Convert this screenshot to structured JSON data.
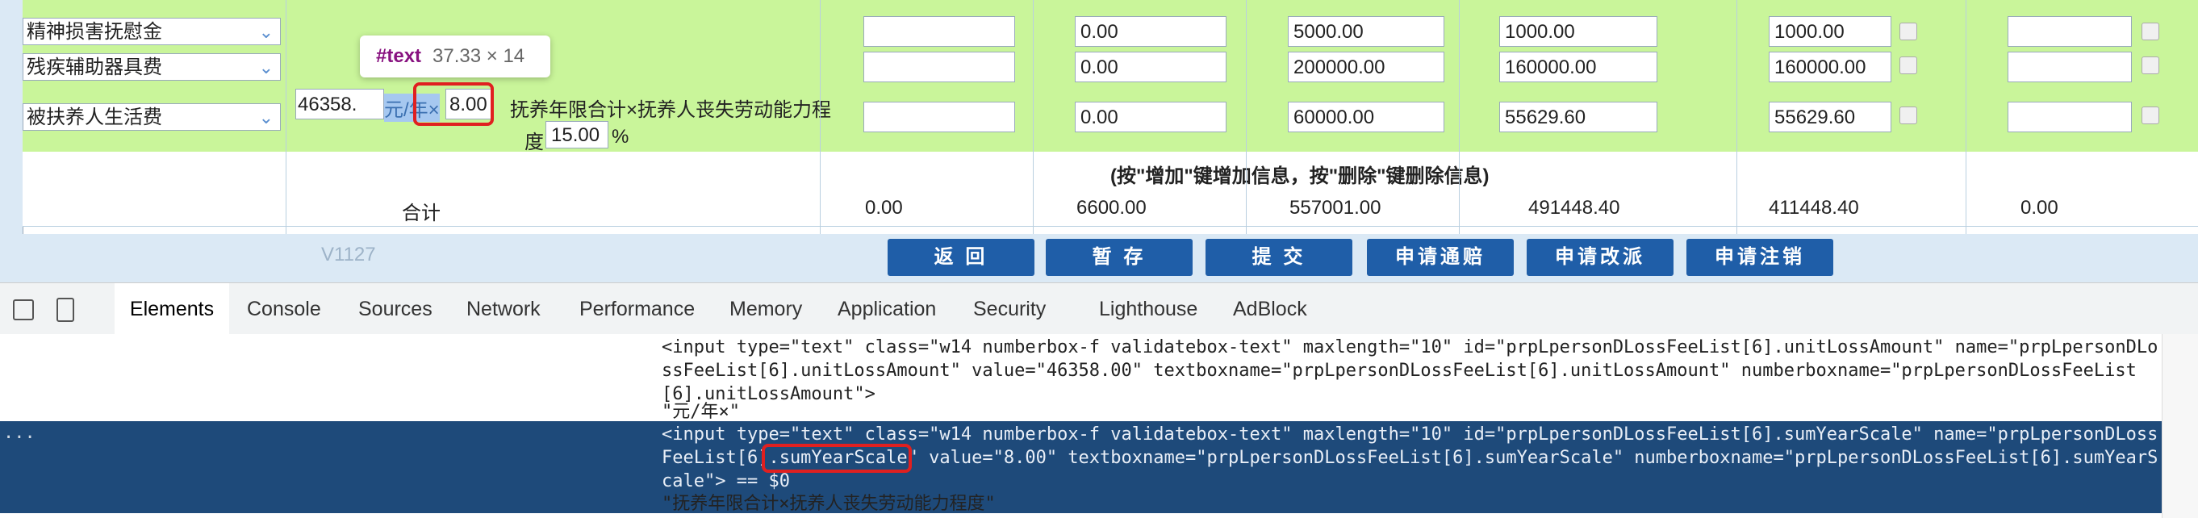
{
  "rows": [
    {
      "name": "精神损害抚慰金",
      "col2": "",
      "c3": "0.00",
      "c4": "5000.00",
      "c5": "1000.00",
      "c6": "1000.00"
    },
    {
      "name": "残疾辅助器具费",
      "col2": "",
      "c3": "0.00",
      "c4": "200000.00",
      "c5": "160000.00",
      "c6": "160000.00"
    },
    {
      "name": "被扶养人生活费",
      "unit_value": "46358.",
      "unit_text": "元/年×",
      "years": "8.00",
      "formula": "抚养年限合计×抚养人丧失劳动能力程",
      "formula2": "度",
      "pct": "15.00",
      "pct_sign": "%",
      "c3": "0.00",
      "c4": "60000.00",
      "c5": "55629.60",
      "c6": "55629.60"
    }
  ],
  "note": "(按\"增加\"键增加信息，按\"删除\"键删除信息)",
  "total": {
    "label": "合计",
    "v1": "0.00",
    "v2": "6600.00",
    "v3": "557001.00",
    "v4": "491448.40",
    "v5": "411448.40",
    "v6": "0.00"
  },
  "version": "V1127",
  "buttons": [
    "返 回",
    "暂 存",
    "提 交",
    "申请通赔",
    "申请改派",
    "申请注销"
  ],
  "tooltip": {
    "tag": "#text",
    "dims": "37.33 × 14"
  },
  "devtools": {
    "tabs": [
      "Elements",
      "Console",
      "Sources",
      "Network",
      "Performance",
      "Memory",
      "Application",
      "Security",
      "Lighthouse",
      "AdBlock"
    ],
    "active_tab": "Elements",
    "lines": [
      "<input type=\"text\" class=\"w14 numberbox-f validatebox-text\" maxlength=\"10\" id=\"prpLpersonDLossFeeList[6].unitLossAmount\" name=\"prpLpersonDLo",
      "ssFeeList[6].unitLossAmount\" value=\"46358.00\" textboxname=\"prpLpersonDLossFeeList[6].unitLossAmount\" numberboxname=\"prpLpersonDLossFeeList",
      "[6].unitLossAmount\">",
      "\"元/年×\"",
      "<input type=\"text\" class=\"w14 numberbox-f validatebox-text\" maxlength=\"10\" id=\"prpLpersonDLossFeeList[6].sumYearScale\" name=\"prpLpersonDLoss",
      "FeeList[6].sumYearScale\" value=\"8.00\" textboxname=\"prpLpersonDLossFeeList[6].sumYearScale\" numberboxname=\"prpLpersonDLossFeeList[6].sumYearS",
      "cale\"> == $0",
      "\"抚养年限合计×抚养人丧失劳动能力程度\""
    ],
    "dots": "..."
  }
}
